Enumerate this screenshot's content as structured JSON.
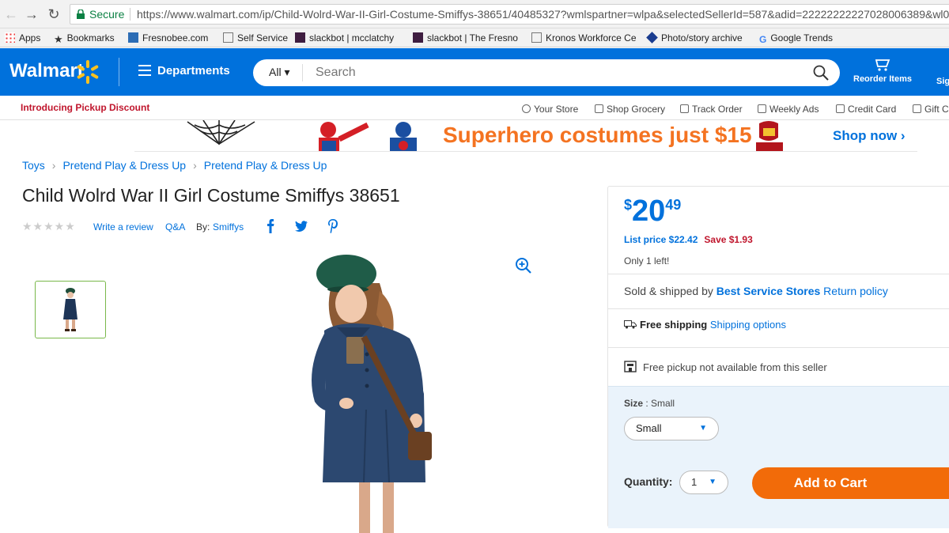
{
  "browser": {
    "secure_label": "Secure",
    "url": "https://www.walmart.com/ip/Child-Wolrd-War-II-Girl-Costume-Smiffys-38651/40485327?wmlspartner=wlpa&selectedSellerId=587&adid=22222222227028006389&wl0",
    "bookmarks": [
      "Apps",
      "Bookmarks",
      "Fresnobee.com",
      "Self Service",
      "slackbot | mcclatchy",
      "slackbot | The Fresno",
      "Kronos Workforce Ce",
      "Photo/story archive",
      "Google Trends"
    ]
  },
  "header": {
    "logo": "Walmart",
    "departments": "Departments",
    "search_scope": "All",
    "search_placeholder": "Search",
    "reorder": "Reorder Items",
    "sign": "Sig"
  },
  "subnav": {
    "promo": "Introducing Pickup Discount",
    "items": [
      "Your Store",
      "Shop Grocery",
      "Track Order",
      "Weekly Ads",
      "Credit Card",
      "Gift C"
    ]
  },
  "banner": {
    "headline": "Superhero costumes just $15",
    "cta": "Shop now ›"
  },
  "breadcrumbs": [
    "Toys",
    "Pretend Play & Dress Up",
    "Pretend Play & Dress Up"
  ],
  "product": {
    "title": "Child Wolrd War II Girl Costume Smiffys 38651",
    "write_review": "Write a review",
    "qa": "Q&A",
    "by": "By:",
    "brand": "Smiffys"
  },
  "buybox": {
    "currency": "$",
    "price_dollars": "20",
    "price_cents": "49",
    "list_price": "List price $22.42",
    "save": "Save $1.93",
    "stock": "Only 1 left!",
    "sold_prefix": "Sold & shipped by",
    "seller": "Best Service Stores",
    "return_policy": "Return policy",
    "free_shipping": "Free shipping",
    "shipping_options": "Shipping options",
    "pickup": "Free pickup not available from this seller",
    "size_label": "Size",
    "size_value": "Small",
    "size_selected": "Small",
    "quantity_label": "Quantity:",
    "quantity_value": "1",
    "add_to_cart": "Add to Cart"
  },
  "colors": {
    "walmart_blue": "#0071dc",
    "spark_yellow": "#ffc220",
    "cart_orange": "#f26b09",
    "save_red": "#c0162d"
  }
}
